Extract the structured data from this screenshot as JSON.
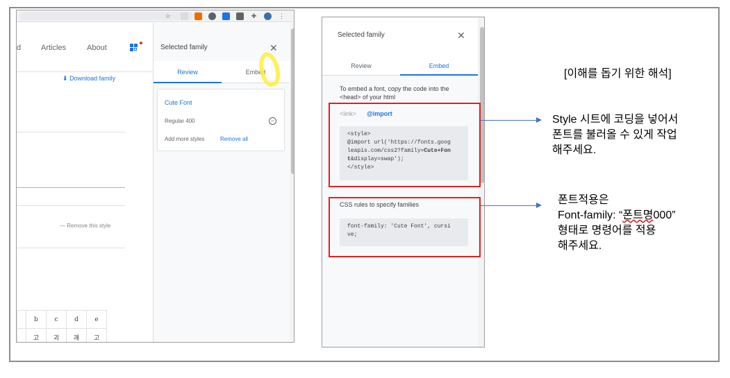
{
  "left": {
    "nav": {
      "cut": "d",
      "articles": "Articles",
      "about": "About"
    },
    "download": "Download family",
    "remove_style": "Remove this style",
    "grid_row1": [
      "b",
      "c",
      "d",
      "e"
    ],
    "grid_row2": [
      "고",
      "괴",
      "괘",
      "고"
    ],
    "panel": {
      "title": "Selected family",
      "close": "✕",
      "tab_review": "Review",
      "tab_embed": "Embed",
      "font_name": "Cute Font",
      "style": "Regular 400",
      "add_more": "Add more styles",
      "remove_all": "Remove all"
    }
  },
  "right": {
    "title": "Selected family",
    "close": "✕",
    "tab_review": "Review",
    "tab_embed": "Embed",
    "instructions": "To embed a font, copy the code into the <head> of your html",
    "link_tab": "<link>",
    "import_tab": "@import",
    "code_line1": "<style>",
    "code_line2": "@import url('https://fonts.goog",
    "code_line3": "leapis.com/css2?family=",
    "code_line3_bold": "Cute+Fon",
    "code_line4_bold": "t",
    "code_line4": "&display=swap');",
    "code_line5": "</style>",
    "css_title": "CSS rules to specify families",
    "css_line1": "font-family: 'Cute Font', cursi",
    "css_line2": "ve;"
  },
  "annotations": {
    "header": "[이해를 돕기 위한 해석]",
    "style_note_1": "Style 시트에 코딩을 넣어서",
    "style_note_2": "폰트를 불러올 수 있게 작업",
    "style_note_3": "해주세요.",
    "font_note_1": "폰트적용은",
    "font_note_2a": "Font-family: “",
    "font_note_2b": "폰트명",
    "font_note_2c": "000”",
    "font_note_3": "형태로 명령어를 적용",
    "font_note_4": "해주세요."
  },
  "colors": {
    "accent": "#1a73e8",
    "highlight": "#e02020",
    "arrow": "#4472c4",
    "marker": "#ffef3a"
  }
}
